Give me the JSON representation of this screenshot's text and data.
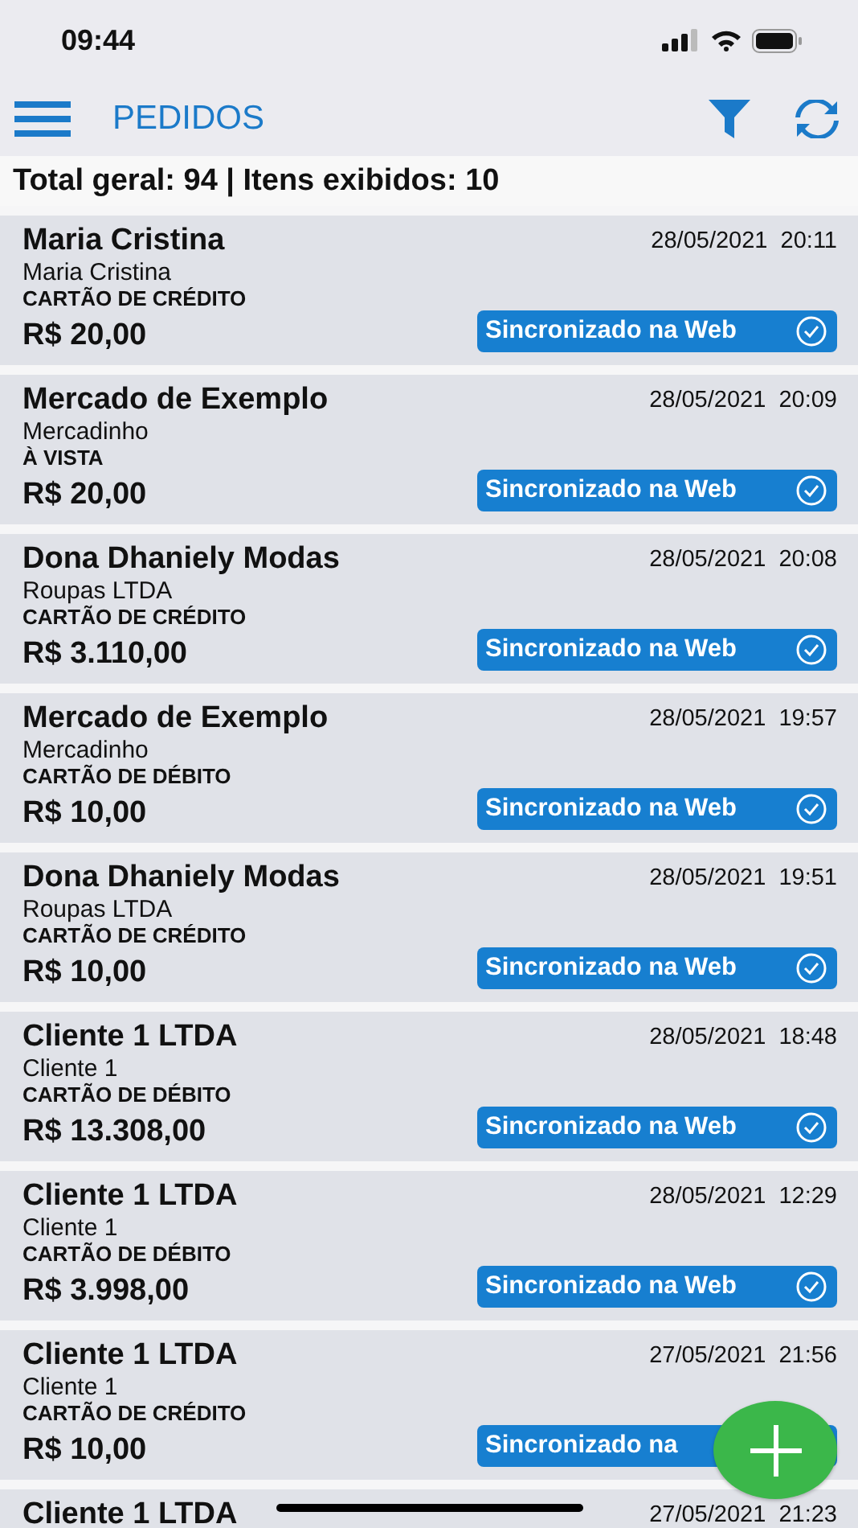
{
  "status_bar": {
    "time": "09:44"
  },
  "nav": {
    "title": "PEDIDOS"
  },
  "summary": "Total geral: 94 | Itens exibidos: 10",
  "orders": [
    {
      "customer": "Maria Cristina",
      "company": "Maria Cristina",
      "payment": "CARTÃO DE CRÉDITO",
      "total": "R$ 20,00",
      "date": "28/05/2021",
      "time": "20:11",
      "badge": "Sincronizado na Web",
      "check": true
    },
    {
      "customer": "Mercado de Exemplo",
      "company": "Mercadinho",
      "payment": "À VISTA",
      "total": "R$ 20,00",
      "date": "28/05/2021",
      "time": "20:09",
      "badge": "Sincronizado na Web",
      "check": true
    },
    {
      "customer": "Dona Dhaniely Modas",
      "company": "Roupas LTDA",
      "payment": "CARTÃO DE CRÉDITO",
      "total": "R$ 3.110,00",
      "date": "28/05/2021",
      "time": "20:08",
      "badge": "Sincronizado na Web",
      "check": true
    },
    {
      "customer": "Mercado de Exemplo",
      "company": "Mercadinho",
      "payment": "CARTÃO DE DÉBITO",
      "total": "R$ 10,00",
      "date": "28/05/2021",
      "time": "19:57",
      "badge": "Sincronizado na Web",
      "check": true
    },
    {
      "customer": "Dona Dhaniely Modas",
      "company": "Roupas LTDA",
      "payment": "CARTÃO DE CRÉDITO",
      "total": "R$ 10,00",
      "date": "28/05/2021",
      "time": "19:51",
      "badge": "Sincronizado na Web",
      "check": true
    },
    {
      "customer": "Cliente 1 LTDA",
      "company": "Cliente 1",
      "payment": "CARTÃO DE DÉBITO",
      "total": "R$ 13.308,00",
      "date": "28/05/2021",
      "time": "18:48",
      "badge": "Sincronizado na Web",
      "check": true
    },
    {
      "customer": "Cliente 1 LTDA",
      "company": "Cliente 1",
      "payment": "CARTÃO DE DÉBITO",
      "total": "R$ 3.998,00",
      "date": "28/05/2021",
      "time": "12:29",
      "badge": "Sincronizado na Web",
      "check": true
    },
    {
      "customer": "Cliente 1 LTDA",
      "company": "Cliente 1",
      "payment": "CARTÃO DE CRÉDITO",
      "total": "R$ 10,00",
      "date": "27/05/2021",
      "time": "21:56",
      "badge": "Sincronizado na"
    },
    {
      "customer": "Cliente 1 LTDA",
      "date": "27/05/2021",
      "time": "21:23"
    }
  ]
}
